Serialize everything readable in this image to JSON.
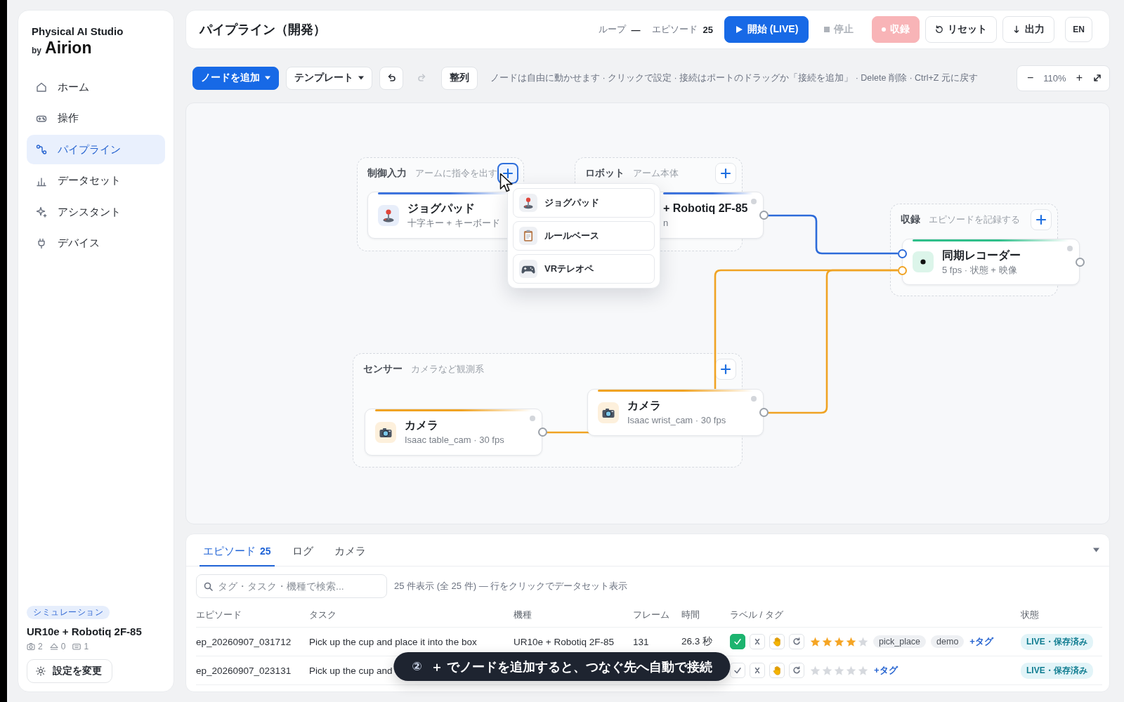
{
  "sidebar": {
    "logo": {
      "title": "Physical AI Studio",
      "by": "by",
      "brand": "Airion"
    },
    "nav": [
      {
        "kind": "home",
        "label": "ホーム",
        "selected": false
      },
      {
        "kind": "control",
        "label": "操作",
        "selected": false
      },
      {
        "kind": "pipeline",
        "label": "パイプライン",
        "selected": true
      },
      {
        "kind": "dataset",
        "label": "データセット",
        "selected": false
      },
      {
        "kind": "assistant",
        "label": "アシスタント",
        "selected": false
      },
      {
        "kind": "device",
        "label": "デバイス",
        "selected": false
      }
    ],
    "device": {
      "mode": "シミュレーション",
      "name": "UR10e + Robotiq 2F-85",
      "stats": [
        {
          "kind": "camera",
          "count": "2"
        },
        {
          "kind": "arm",
          "count": "0"
        },
        {
          "kind": "keyboard",
          "count": "1"
        }
      ],
      "settings_button": "設定を変更"
    }
  },
  "header": {
    "title": "パイプライン（開発）",
    "loop": {
      "label": "ループ",
      "value": "—"
    },
    "episodes": {
      "label": "エピソード",
      "value": "25"
    },
    "buttons": [
      {
        "kind": "start",
        "label": "開始 (LIVE)",
        "disabled": false
      },
      {
        "kind": "stop",
        "label": "停止",
        "disabled": true
      },
      {
        "kind": "record",
        "label": "収録",
        "disabled": true
      },
      {
        "kind": "reset",
        "label": "リセット",
        "disabled": false
      },
      {
        "kind": "export",
        "label": "出力",
        "disabled": false
      },
      {
        "kind": "language",
        "label": "EN",
        "disabled": false
      }
    ]
  },
  "toolbar": {
    "add_node": "ノードを追加",
    "template": "テンプレート",
    "undo": {
      "disabled": false
    },
    "redo": {
      "disabled": true
    },
    "arrange": "整列",
    "hint": "ノードは自由に動かせます · クリックで設定 · 接続はポートのドラッグか「接続を追加」 · Delete 削除 · Ctrl+Z 元に戻す",
    "zoom": {
      "minus": "−",
      "percent": "110%",
      "plus": "+"
    }
  },
  "canvas": {
    "groups": [
      {
        "title": "制御入力",
        "subtitle": "アームに指令を出す",
        "menu_open": true
      },
      {
        "title": "ロボット",
        "subtitle": "アーム本体",
        "menu_open": false
      },
      {
        "title": "収録",
        "subtitle": "エピソードを記録する",
        "menu_open": false
      },
      {
        "title": "センサー",
        "subtitle": "カメラなど観測系",
        "menu_open": false
      }
    ],
    "nodes": [
      {
        "kind": "jogpad",
        "title": "ジョグパッド",
        "subtitle": "十字キー + キーボード",
        "color": "#3e74de"
      },
      {
        "kind": "robot",
        "title": "+ Robotiq 2F-85",
        "subtitle": "n",
        "color": "#3e74de"
      },
      {
        "kind": "recorder",
        "title": "同期レコーダー",
        "subtitle": "5 fps · 状態 + 映像",
        "color": "#2fbf8a"
      },
      {
        "kind": "camera",
        "title": "カメラ",
        "subtitle": "Isaac table_cam · 30 fps",
        "color": "#f0a323"
      },
      {
        "kind": "camera",
        "title": "カメラ",
        "subtitle": "Isaac wrist_cam · 30 fps",
        "color": "#f0a323"
      }
    ],
    "connections": [
      {
        "color": "#2d6bd9"
      },
      {
        "color": "#f0a323"
      },
      {
        "color": "#f0a323"
      }
    ],
    "add_menu": {
      "items": [
        {
          "kind": "jogpad",
          "label": "ジョグパッド"
        },
        {
          "kind": "rules",
          "label": "ルールベース"
        },
        {
          "kind": "vr",
          "label": "VRテレオペ"
        }
      ]
    }
  },
  "panel": {
    "tabs": [
      {
        "label": "エピソード",
        "count": "25",
        "selected": true
      },
      {
        "label": "ログ",
        "selected": false
      },
      {
        "label": "カメラ",
        "selected": false
      }
    ],
    "search": {
      "placeholder": "タグ・タスク・機種で検索..."
    },
    "summary": "25 件表示 (全 25 件) — 行をクリックでデータセット表示",
    "table": {
      "columns": [
        "エピソード",
        "タスク",
        "機種",
        "フレーム",
        "時間",
        "ラベル / タグ",
        "状態"
      ],
      "rows": [
        {
          "episode": "ep_20260907_031712",
          "task": "Pick up the cup and place it into the box",
          "robot": "UR10e + Robotiq 2F-85",
          "frames": "131",
          "duration": "26.3 秒",
          "labels": [
            {
              "kind": "accept",
              "selected": true
            },
            {
              "kind": "reject",
              "selected": false
            },
            {
              "kind": "intervene",
              "selected": false
            },
            {
              "kind": "retry",
              "selected": false
            }
          ],
          "stars": 4,
          "tags": [
            "pick_place",
            "demo"
          ],
          "add_tag": "+タグ",
          "status": "LIVE・保存済み"
        },
        {
          "episode": "ep_20260907_023131",
          "task": "Pick up the cup and",
          "labels": [
            {
              "kind": "accept",
              "selected": false
            },
            {
              "kind": "reject",
              "selected": false
            },
            {
              "kind": "intervene",
              "selected": false
            },
            {
              "kind": "retry",
              "selected": false
            }
          ],
          "stars": 0,
          "add_tag": "+タグ",
          "status": "LIVE・保存済み"
        }
      ]
    }
  },
  "toast": {
    "step": "②",
    "message": "＋ でノードを追加すると、つなぐ先へ自動で接続"
  }
}
